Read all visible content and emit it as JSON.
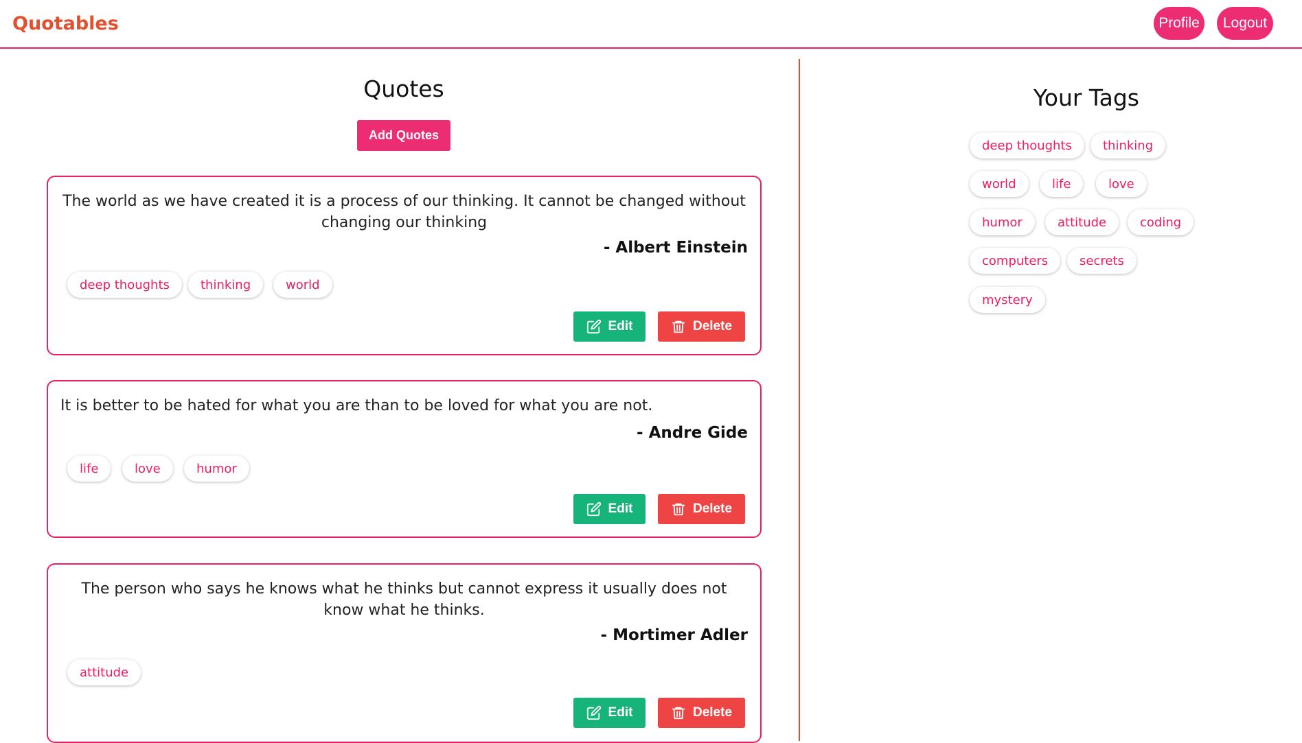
{
  "navbar": {
    "brand": "Quotables",
    "profile_label": "Profile",
    "logout_label": "Logout"
  },
  "quotes_section": {
    "title": "Quotes",
    "add_label": "Add Quotes"
  },
  "quotes": [
    {
      "text": "The world as we have created it is a process of our thinking. It cannot be changed without changing our thinking",
      "author": "- Albert Einstein",
      "tags": [
        "deep thoughts",
        "thinking",
        "world"
      ],
      "edit_label": "Edit",
      "delete_label": "Delete"
    },
    {
      "text": "It is better to be hated for what you are than to be loved for what you are not.",
      "author": "- Andre Gide",
      "tags": [
        "life",
        "love",
        "humor"
      ],
      "edit_label": "Edit",
      "delete_label": "Delete"
    },
    {
      "text": "The person who says he knows what he thinks but cannot express it usually does not know what he thinks.",
      "author": "- Mortimer Adler",
      "tags": [
        "attitude"
      ],
      "edit_label": "Edit",
      "delete_label": "Delete"
    }
  ],
  "tags_section": {
    "title": "Your Tags",
    "tags": [
      "deep thoughts",
      "thinking",
      "world",
      "life",
      "love",
      "humor",
      "attitude",
      "coding",
      "computers",
      "secrets",
      "mystery"
    ]
  },
  "icons": {
    "edit": "edit-square-pen-icon",
    "delete": "trash-can-icon"
  },
  "colors": {
    "brand": "#e2512f",
    "accent": "#ec2c73",
    "tag_text": "#e91e63",
    "edit": "#16b37b",
    "delete": "#ef4444"
  }
}
